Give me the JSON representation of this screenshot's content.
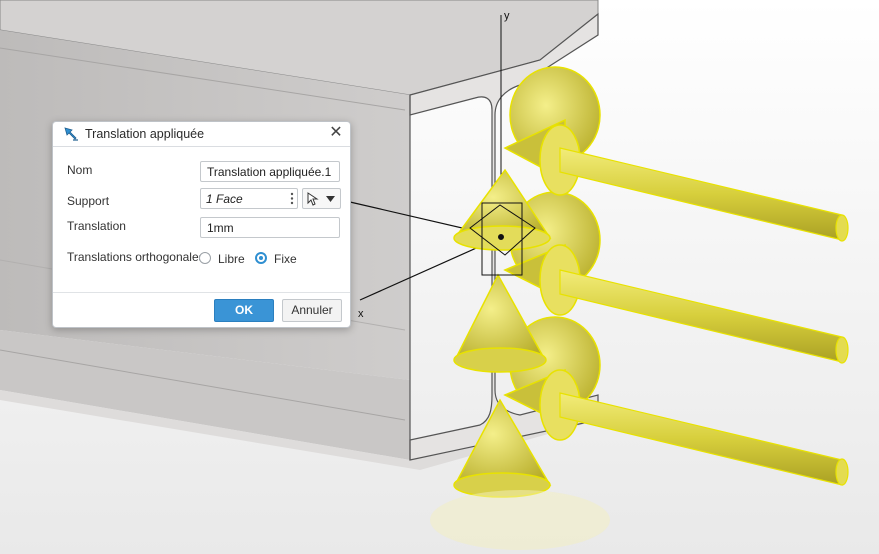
{
  "dialog": {
    "title": "Translation appliquée",
    "close_icon": "close-icon",
    "fields": {
      "nom_label": "Nom",
      "nom_value": "Translation appliquée.1",
      "support_label": "Support",
      "support_value": "1 Face",
      "translation_label": "Translation",
      "translation_value": "1mm",
      "ortho_label": "Translations orthogonales",
      "ortho_options": [
        "Libre",
        "Fixe"
      ],
      "ortho_selected": "Fixe"
    },
    "buttons": {
      "ok": "OK",
      "cancel": "Annuler"
    },
    "accent": "#3a94d6"
  },
  "scene": {
    "axis_x": "x",
    "axis_y": "y",
    "load_color": "#e6e05c"
  }
}
